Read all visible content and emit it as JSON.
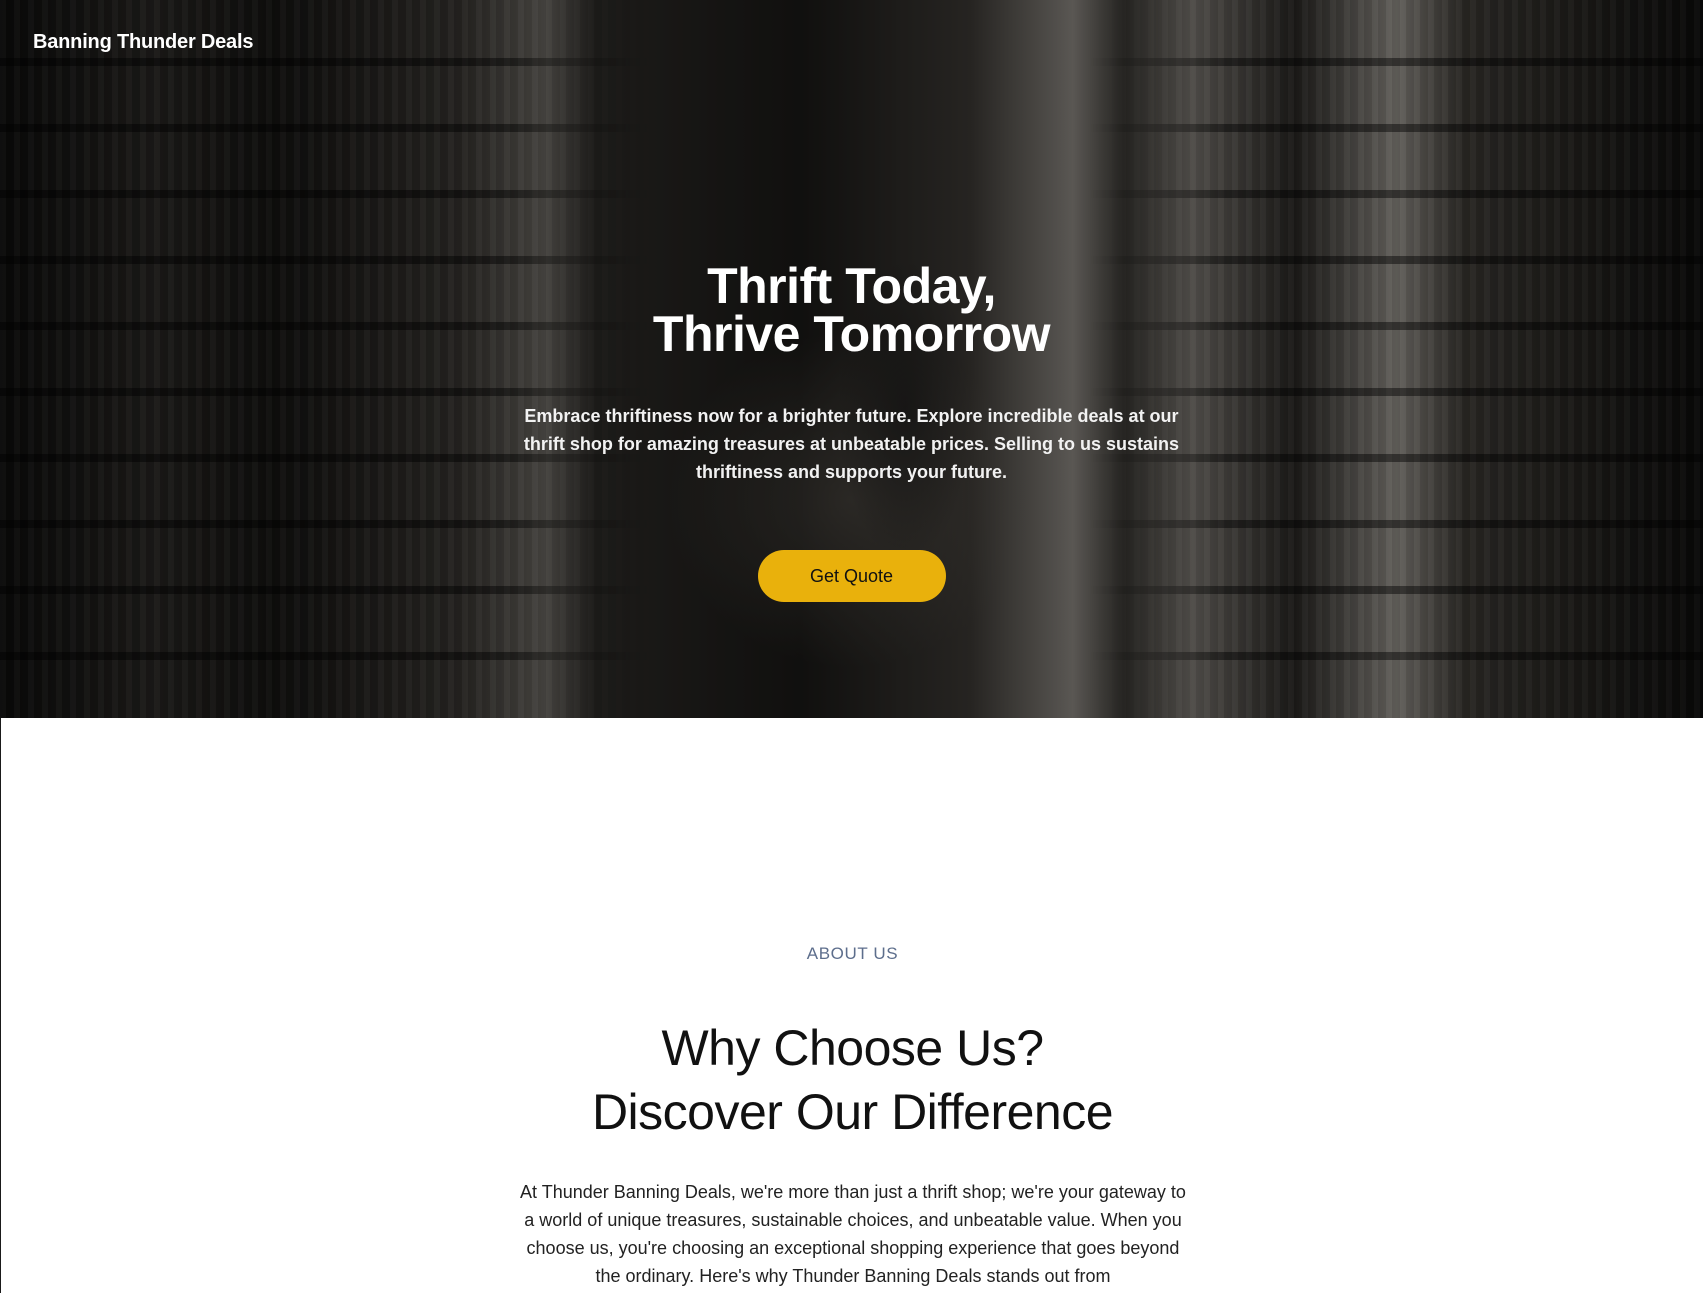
{
  "brand": {
    "name": "Banning Thunder Deals"
  },
  "hero": {
    "title_line1": "Thrift Today,",
    "title_line2": "Thrive Tomorrow",
    "subtitle": "Embrace thriftiness now for a brighter future. Explore incredible deals at our thrift shop for amazing treasures at unbeatable prices. Selling to us sustains thriftiness and supports your future.",
    "cta_label": "Get Quote",
    "cta_color": "#e9b10c"
  },
  "about": {
    "eyebrow": "ABOUT US",
    "title_line1": "Why Choose Us?",
    "title_line2": "Discover Our Difference",
    "body": "At Thunder Banning Deals, we're more than just a thrift shop; we're your gateway to a world of unique treasures, sustainable choices, and unbeatable value. When you choose us, you're choosing an exceptional shopping experience that goes beyond the ordinary. Here's why Thunder Banning Deals stands out from",
    "eyebrow_color": "#5d6e8c"
  }
}
